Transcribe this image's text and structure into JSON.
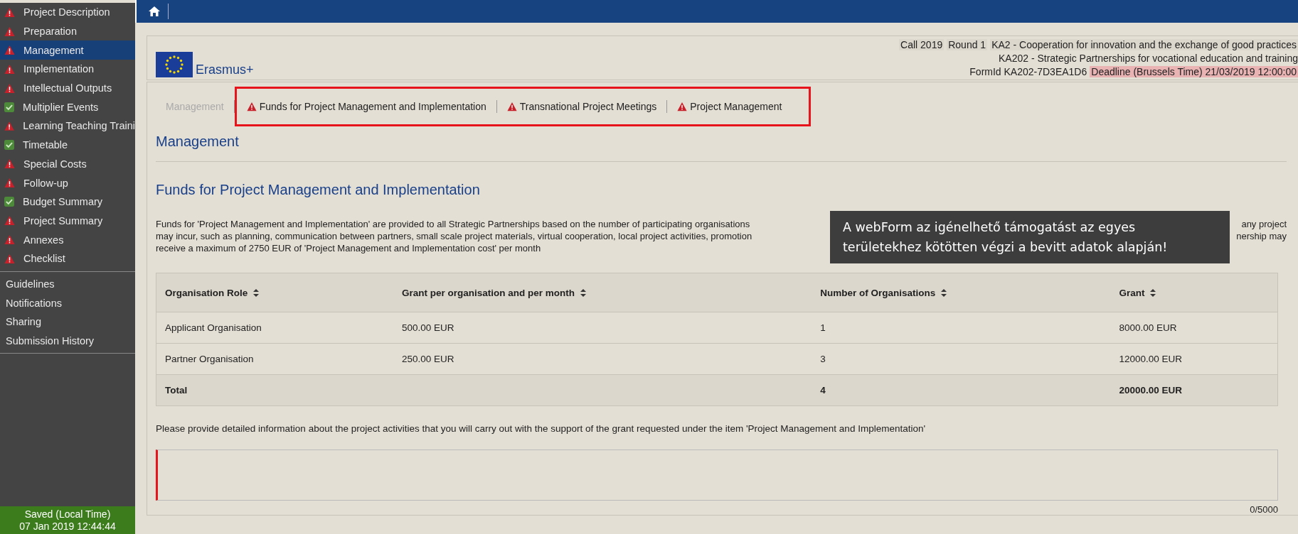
{
  "sidebar": {
    "items": [
      {
        "label": "Project Description",
        "warning": true,
        "selected": false
      },
      {
        "label": "Preparation",
        "warning": true,
        "selected": false
      },
      {
        "label": "Management",
        "warning": true,
        "selected": true
      },
      {
        "label": "Implementation",
        "warning": true,
        "selected": false
      },
      {
        "label": "Intellectual Outputs",
        "warning": true,
        "selected": false
      },
      {
        "label": "Multiplier Events",
        "warning": false,
        "selected": false
      },
      {
        "label": "Learning Teaching Traini",
        "warning": true,
        "selected": false
      },
      {
        "label": "Timetable",
        "warning": false,
        "selected": false
      },
      {
        "label": "Special Costs",
        "warning": true,
        "selected": false
      },
      {
        "label": "Follow-up",
        "warning": true,
        "selected": false
      },
      {
        "label": "Budget Summary",
        "warning": false,
        "selected": false
      },
      {
        "label": "Project Summary",
        "warning": true,
        "selected": false
      },
      {
        "label": "Annexes",
        "warning": true,
        "selected": false
      },
      {
        "label": "Checklist",
        "warning": true,
        "selected": false
      }
    ],
    "links": [
      "Guidelines",
      "Notifications",
      "Sharing",
      "Submission History"
    ],
    "saved": {
      "label": "Saved (Local Time)",
      "time": "07 Jan 2019 12:44:44"
    }
  },
  "header": {
    "logo_text": "Erasmus+",
    "call": [
      "Call 2019",
      "Round 1",
      "KA2 - Cooperation for innovation and the exchange of good practices"
    ],
    "action": "KA202 - Strategic Partnerships for vocational education and training",
    "form_id": "FormId KA202-7D3EA1D6",
    "deadline": "Deadline (Brussels Time) 21/03/2019 12:00:00"
  },
  "tabs": [
    {
      "label": "Management",
      "selected": true,
      "warning": false
    },
    {
      "label": "Funds for Project Management and Implementation",
      "selected": false,
      "warning": true
    },
    {
      "label": "Transnational Project Meetings",
      "selected": false,
      "warning": true
    },
    {
      "label": "Project Management",
      "selected": false,
      "warning": true
    }
  ],
  "page_title": "Management",
  "section_title": "Funds for Project Management and Implementation",
  "description_lines": [
    {
      "left": "Funds for 'Project Management and Implementation' are provided to all Strategic Partnerships based on the number of participating organisations",
      "right": "any project"
    },
    {
      "left": "may incur, such as planning, communication between partners, small scale project materials, virtual cooperation, local project activities, promotion",
      "right": "nership may"
    },
    {
      "left": "receive a maximum of 2750 EUR of 'Project Management and Implementation cost' per month"
    }
  ],
  "callout": "A webForm az igénelhető támogatást az egyes területekhez kötötten végzi a bevitt adatok alapján!",
  "table": {
    "columns": [
      "Organisation Role",
      "Grant per organisation and per month",
      "Number of Organisations",
      "Grant"
    ],
    "rows": [
      {
        "kind": "normal",
        "cells": [
          "Applicant Organisation",
          "500.00 EUR",
          "1",
          "8000.00 EUR"
        ]
      },
      {
        "kind": "normal",
        "cells": [
          "Partner Organisation",
          "250.00 EUR",
          "3",
          "12000.00 EUR"
        ]
      },
      {
        "kind": "total",
        "cells": [
          "Total",
          "",
          "4",
          "20000.00 EUR"
        ]
      }
    ]
  },
  "question": "Please provide detailed information about the project activities that you will carry out with the support of the grant requested under the item 'Project Management and Implementation'",
  "answer": {
    "required": true,
    "counter": "0/5000"
  }
}
